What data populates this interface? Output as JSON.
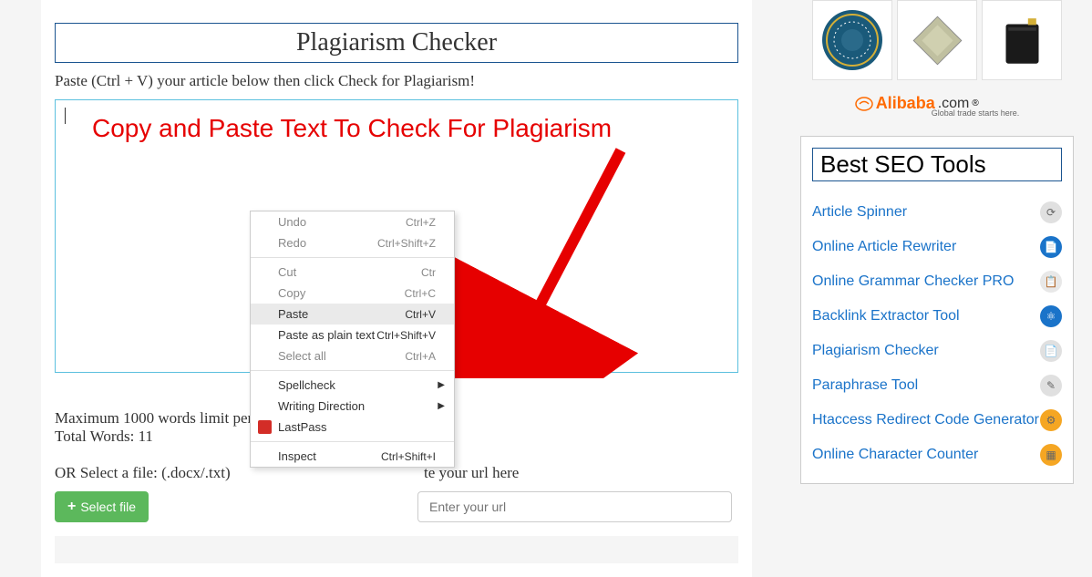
{
  "main": {
    "title": "Plagiarism Checker",
    "instruction": "Paste (Ctrl + V) your article below then click Check for Plagiarism!",
    "overlay": "Copy and Paste Text To Check For Plagiarism",
    "limit_text": "Maximum 1000 words limit per s",
    "total_words": "Total Words: 11",
    "file_label": "OR Select a file: (.docx/.txt)",
    "paste_url_label": "te your url here",
    "select_file_btn": "Select file",
    "url_placeholder": "Enter your url"
  },
  "context_menu": {
    "items": [
      {
        "label": "Undo",
        "shortcut": "Ctrl+Z",
        "active": false
      },
      {
        "label": "Redo",
        "shortcut": "Ctrl+Shift+Z",
        "active": false
      },
      {
        "divider": true
      },
      {
        "label": "Cut",
        "shortcut": "Ctr",
        "active": false
      },
      {
        "label": "Copy",
        "shortcut": "Ctrl+C",
        "active": false
      },
      {
        "label": "Paste",
        "shortcut": "Ctrl+V",
        "active": true,
        "highlighted": true
      },
      {
        "label": "Paste as plain text",
        "shortcut": "Ctrl+Shift+V",
        "active": true
      },
      {
        "label": "Select all",
        "shortcut": "Ctrl+A",
        "active": false
      },
      {
        "divider": true
      },
      {
        "label": "Spellcheck",
        "submenu": true,
        "active": true
      },
      {
        "label": "Writing Direction",
        "submenu": true,
        "active": true
      },
      {
        "label": "LastPass",
        "icon": "lastpass",
        "active": true
      },
      {
        "divider": true
      },
      {
        "label": "Inspect",
        "shortcut": "Ctrl+Shift+I",
        "active": true
      }
    ]
  },
  "sidebar": {
    "alibaba_brand": "Alibaba",
    "alibaba_suffix": ".com",
    "alibaba_tagline": "Global trade starts here.",
    "seo_title": "Best SEO Tools",
    "tools": [
      {
        "name": "Article Spinner",
        "color": "#e0e0e0"
      },
      {
        "name": "Online Article Rewriter",
        "color": "#1a73c9"
      },
      {
        "name": "Online Grammar Checker PRO",
        "color": "#e8e8e8"
      },
      {
        "name": "Backlink Extractor Tool",
        "color": "#1a73c9"
      },
      {
        "name": "Plagiarism Checker",
        "color": "#e0e0e0"
      },
      {
        "name": "Paraphrase Tool",
        "color": "#e0e0e0"
      },
      {
        "name": "Htaccess Redirect Code Generator",
        "color": "#f5a623"
      },
      {
        "name": "Online Character Counter",
        "color": "#f5a623"
      }
    ]
  }
}
